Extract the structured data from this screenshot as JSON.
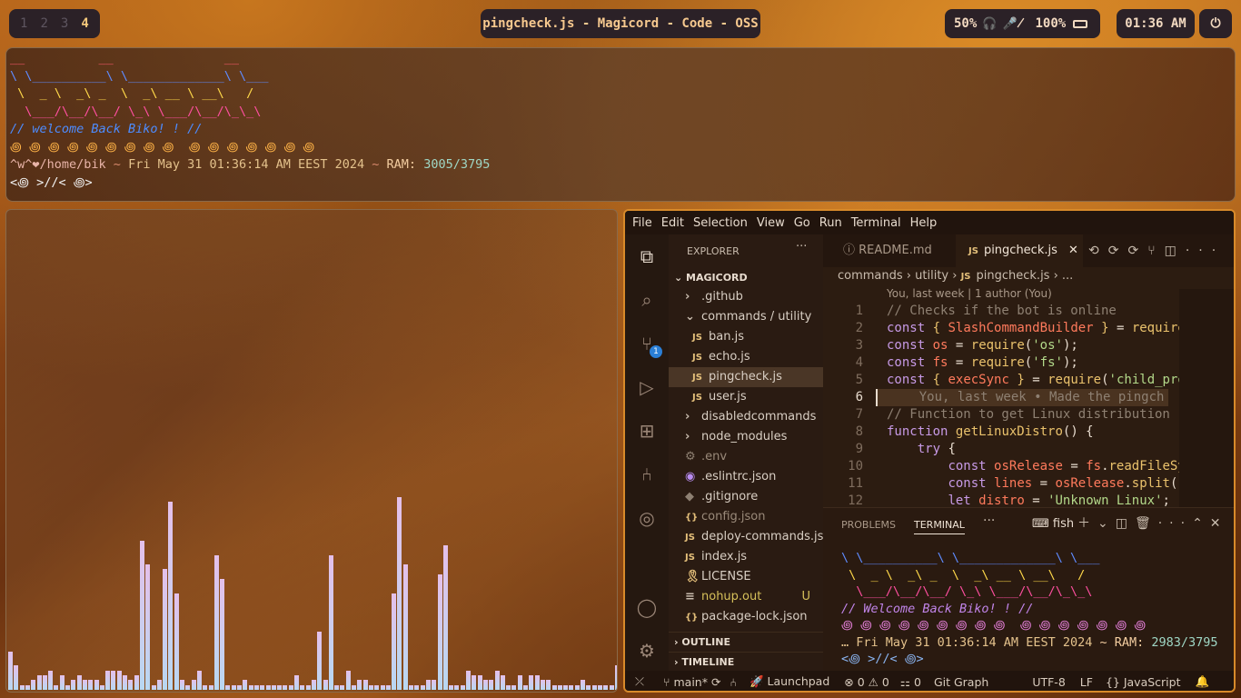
{
  "topbar": {
    "workspaces": [
      "1",
      "2",
      "3",
      "4"
    ],
    "active_workspace": "4",
    "window_title": "pingcheck.js - Magicord - Code - OSS",
    "volume": "50%",
    "battery": "100%",
    "clock": "01:36 AM"
  },
  "terminal_top": {
    "ascii": [
      "__          __               __",
      "\\ \\__________\\ \\_____________\\ \\___",
      " \\  _ \\  _\\ _  \\  _\\ __ \\ __\\   /",
      "  \\___/\\__/\\__/ \\_\\ \\___/\\__/\\_\\_\\"
    ],
    "welcome": "// welcome Back Biko! ! //",
    "rainbow": "꩜ ꩜ ꩜ ꩜ ꩜ ꩜ ꩜ ꩜ ꩜  ꩜ ꩜ ꩜ ꩜ ꩜ ꩜ ꩜",
    "prompt_user": "^w^❤/home/bik",
    "prompt_sep": " ~ ",
    "prompt_date": "Fri May 31 01:36:14 AM EEST 2024",
    "prompt_ram_label": "RAM: ",
    "prompt_ram": "3005/3795",
    "prompt_line": "<꩜ >//< ꩜>"
  },
  "cava": {
    "levels": [
      0.08,
      0.05,
      0.01,
      0.01,
      0.02,
      0.03,
      0.03,
      0.04,
      0.01,
      0.03,
      0.01,
      0.02,
      0.03,
      0.02,
      0.02,
      0.02,
      0.01,
      0.04,
      0.04,
      0.04,
      0.03,
      0.02,
      0.03,
      0.31,
      0.26,
      0.01,
      0.02,
      0.25,
      0.39,
      0.2,
      0.02,
      0.01,
      0.02,
      0.04,
      0.01,
      0.01,
      0.28,
      0.23,
      0.01,
      0.01,
      0.01,
      0.02,
      0.01,
      0.01,
      0.01,
      0.01,
      0.01,
      0.01,
      0.01,
      0.01,
      0.03,
      0.01,
      0.01,
      0.02,
      0.12,
      0.02,
      0.28,
      0.01,
      0.01,
      0.04,
      0.01,
      0.02,
      0.02,
      0.01,
      0.01,
      0.01,
      0.01,
      0.2,
      0.4,
      0.26,
      0.01,
      0.01,
      0.01,
      0.02,
      0.02,
      0.24,
      0.3,
      0.01,
      0.01,
      0.01,
      0.04,
      0.03,
      0.03,
      0.02,
      0.02,
      0.04,
      0.03,
      0.01,
      0.01,
      0.03,
      0.01,
      0.03,
      0.03,
      0.02,
      0.02,
      0.01,
      0.01,
      0.01,
      0.01,
      0.01,
      0.02,
      0.01,
      0.01,
      0.01,
      0.01,
      0.01,
      0.05,
      0.08
    ]
  },
  "vscode": {
    "menu": [
      "File",
      "Edit",
      "Selection",
      "View",
      "Go",
      "Run",
      "Terminal",
      "Help"
    ],
    "explorer_title": "EXPLORER",
    "project": "MAGICORD",
    "tree": [
      {
        "label": ".github",
        "kind": "folder",
        "indent": 1
      },
      {
        "label": "commands / utility",
        "kind": "folder-open",
        "indent": 1
      },
      {
        "label": "ban.js",
        "kind": "js",
        "indent": 2
      },
      {
        "label": "echo.js",
        "kind": "js",
        "indent": 2
      },
      {
        "label": "pingcheck.js",
        "kind": "js",
        "indent": 2,
        "active": true
      },
      {
        "label": "user.js",
        "kind": "js",
        "indent": 2
      },
      {
        "label": "disabledcommands",
        "kind": "folder",
        "indent": 1
      },
      {
        "label": "node_modules",
        "kind": "folder",
        "indent": 1
      },
      {
        "label": ".env",
        "kind": "gear",
        "indent": 1
      },
      {
        "label": ".eslintrc.json",
        "kind": "eslint",
        "indent": 1
      },
      {
        "label": ".gitignore",
        "kind": "git",
        "indent": 1
      },
      {
        "label": "config.json",
        "kind": "json",
        "indent": 1
      },
      {
        "label": "deploy-commands.js",
        "kind": "js",
        "indent": 1
      },
      {
        "label": "index.js",
        "kind": "js",
        "indent": 1
      },
      {
        "label": "LICENSE",
        "kind": "license",
        "indent": 1
      },
      {
        "label": "nohup.out",
        "kind": "lines",
        "indent": 1,
        "badge": "U"
      },
      {
        "label": "package-lock.json",
        "kind": "json",
        "indent": 1
      }
    ],
    "outline": "OUTLINE",
    "timeline": "TIMELINE",
    "tabs": [
      {
        "label": "README.md",
        "active": false
      },
      {
        "label": "pingcheck.js",
        "active": true
      }
    ],
    "breadcrumb": [
      "commands",
      "utility",
      "pingcheck.js",
      "..."
    ],
    "blame": "You, last week | 1 author (You)",
    "code_lines": [
      {
        "n": "1",
        "html": "<span class='com'>// Checks if the bot is online</span>"
      },
      {
        "n": "2",
        "html": "<span class='kw'>const</span> <span class='fn'>{</span> <span class='var'>SlashCommandBuilder</span> <span class='fn'>}</span> <span class='pl'>=</span> <span class='fn'>require</span>"
      },
      {
        "n": "3",
        "html": "<span class='kw'>const</span> <span class='var'>os</span> <span class='pl'>=</span> <span class='fn'>require</span><span class='pl'>(</span><span class='str'>'os'</span><span class='pl'>);</span>"
      },
      {
        "n": "4",
        "html": "<span class='kw'>const</span> <span class='var'>fs</span> <span class='pl'>=</span> <span class='fn'>require</span><span class='pl'>(</span><span class='str'>'fs'</span><span class='pl'>);</span>"
      },
      {
        "n": "5",
        "html": "<span class='kw'>const</span> <span class='fn'>{</span> <span class='var'>execSync</span> <span class='fn'>}</span> <span class='pl'>=</span> <span class='fn'>require</span><span class='pl'>(</span><span class='str'>'child_pro</span>"
      },
      {
        "n": "6",
        "html": "<span class='com'>    You, last week • Made the pingch</span>"
      },
      {
        "n": "7",
        "html": "<span class='com'>// Function to get Linux distribution</span>"
      },
      {
        "n": "8",
        "html": "<span class='kw'>function</span> <span class='fn'>getLinuxDistro</span><span class='pl'>() {</span>"
      },
      {
        "n": "9",
        "html": "    <span class='kw'>try</span> <span class='pl'>{</span>"
      },
      {
        "n": "10",
        "html": "        <span class='kw'>const</span> <span class='var'>osRelease</span> <span class='pl'>=</span> <span class='var'>fs</span><span class='pl'>.</span><span class='fn'>readFileSy</span>"
      },
      {
        "n": "11",
        "html": "        <span class='kw'>const</span> <span class='var'>lines</span> <span class='pl'>=</span> <span class='var'>osRelease</span><span class='pl'>.</span><span class='fn'>split</span><span class='pl'>(</span>"
      },
      {
        "n": "12",
        "html": "        <span class='kw'>let</span> <span class='var'>distro</span> <span class='pl'>=</span> <span class='str'>'Unknown Linux'</span><span class='pl'>;</span>"
      }
    ],
    "panel_tabs": [
      "PROBLEMS",
      "TERMINAL"
    ],
    "panel_shell": "fish",
    "terminal_ascii": [
      "\\ \\__________\\ \\_____________\\ \\___",
      " \\  _ \\  _\\ _  \\  _\\ __ \\ __\\   /",
      "  \\___/\\__/\\__/ \\_\\ \\___/\\__/\\_\\_\\"
    ],
    "terminal_welcome": "// Welcome Back Biko! ! //",
    "terminal_rainbow": "꩜ ꩜ ꩜ ꩜ ꩜ ꩜ ꩜ ꩜ ꩜  ꩜ ꩜ ꩜ ꩜ ꩜ ꩜ ꩜",
    "terminal_date": "… Fri May 31 01:36:14 AM EEST 2024",
    "terminal_ram_label": " ~ RAM: ",
    "terminal_ram": "2983/3795",
    "terminal_prompt": "<꩜ >//< ꩜>",
    "status": {
      "branch": "main*",
      "launchpad": "Launchpad",
      "errors": "0",
      "warnings": "0",
      "ports": "0",
      "git_graph": "Git Graph",
      "encoding": "UTF-8",
      "eol": "LF",
      "language": "JavaScript"
    }
  }
}
